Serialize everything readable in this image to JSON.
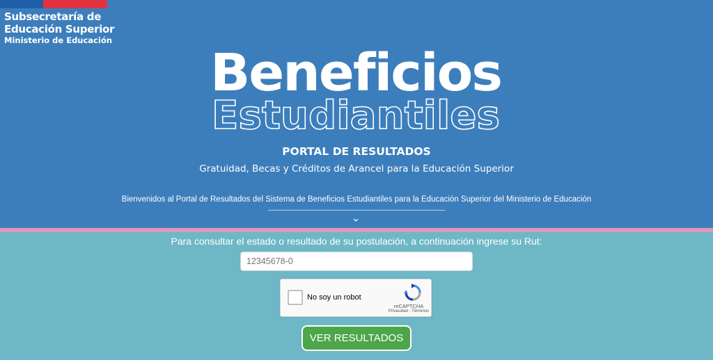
{
  "header": {
    "org_line1": "Subsecretaría de",
    "org_line2": "Educación Superior",
    "org_line3": "Ministerio de Educación",
    "logo_line1": "Beneficios",
    "logo_line2": "Estudiantiles",
    "portal_title": "PORTAL DE RESULTADOS",
    "portal_subtitle": "Gratuidad, Becas y Créditos de Arancel para la Educación Superior",
    "welcome": "Bienvenidos al Portal de Resultados del Sistema de Beneficios Estudiantiles para la Educación Superior del Ministerio de Educación",
    "scroll_icon": "chevron-down-icon"
  },
  "form": {
    "prompt": "Para consultar el estado o resultado de su postulación, a continuación ingrese su Rut:",
    "rut_placeholder": "12345678-0",
    "captcha_label": "No soy un robot",
    "captcha_brand": "reCAPTCHA",
    "captcha_links": "Privacidad - Términos",
    "captcha_icon": "recaptcha-icon",
    "submit_label": "VER RESULTADOS"
  },
  "colors": {
    "header_bg": "#3c7ebc",
    "form_bg": "#6eb7c6",
    "accent_stripe": "#df98b9",
    "submit_button": "#4da64a",
    "flag_blue": "#1f5fa9",
    "flag_red": "#e2323f"
  }
}
